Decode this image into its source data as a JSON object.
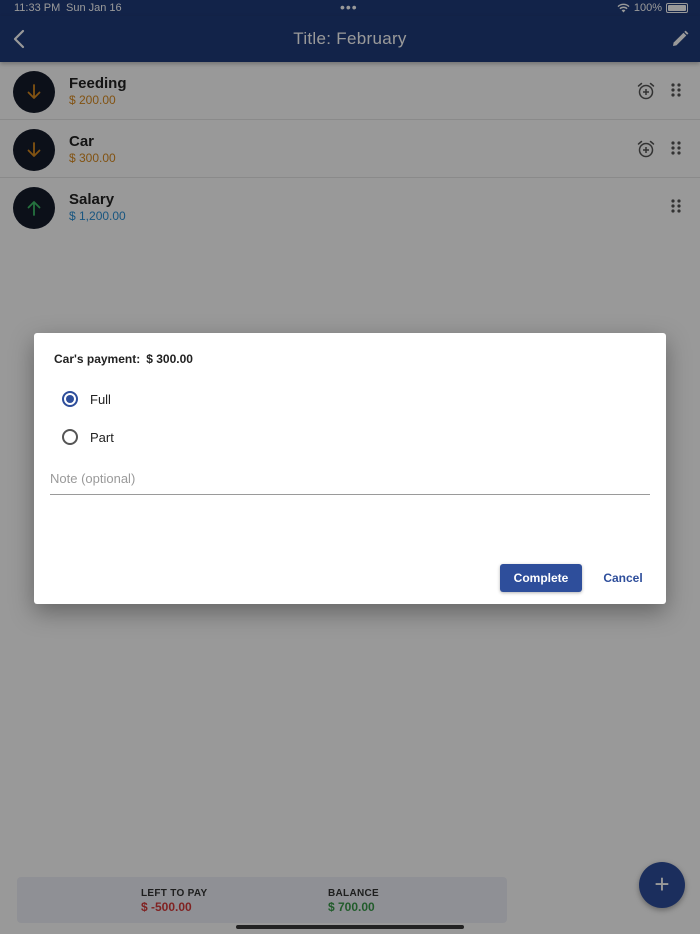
{
  "status_bar": {
    "time": "11:33 PM",
    "date": "Sun Jan 16",
    "dots": "•••",
    "battery": "100%"
  },
  "nav": {
    "title": "Title: February"
  },
  "items": [
    {
      "name": "Feeding",
      "amount": "$ 200.00",
      "direction": "down",
      "icon": "arrow-down-icon",
      "color": "#d98a1f",
      "has_alarm": true
    },
    {
      "name": "Car",
      "amount": "$ 300.00",
      "direction": "down",
      "icon": "arrow-down-icon",
      "color": "#d98a1f",
      "has_alarm": true
    },
    {
      "name": "Salary",
      "amount": "$ 1,200.00",
      "direction": "up",
      "icon": "arrow-up-icon",
      "color": "#2b8fd6",
      "has_alarm": false
    }
  ],
  "footer": {
    "left_to_pay_label": "LEFT TO PAY",
    "left_to_pay_value": "$ -500.00",
    "left_to_pay_color": "#d63a3a",
    "balance_label": "BALANCE",
    "balance_value": "$ 700.00",
    "balance_color": "#3a9a4a"
  },
  "fab": {
    "label": "+"
  },
  "dialog": {
    "title_label": "Car's payment:",
    "title_amount": "$ 300.00",
    "options": [
      {
        "label": "Full",
        "checked": true
      },
      {
        "label": "Part",
        "checked": false
      }
    ],
    "note_placeholder": "Note (optional)",
    "note_value": "",
    "complete_label": "Complete",
    "cancel_label": "Cancel"
  },
  "colors": {
    "primary": "#1f3b7a",
    "accent": "#2e4e9b"
  }
}
